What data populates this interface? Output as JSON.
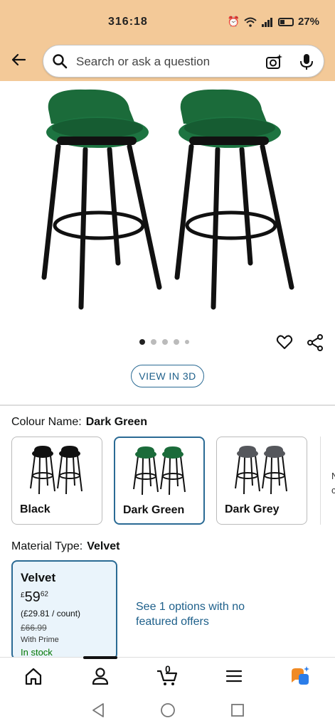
{
  "status_bar": {
    "time": "316:18",
    "battery": "27%",
    "icons": [
      "alarm-icon",
      "wifi-icon",
      "signal-icon",
      "battery-icon"
    ]
  },
  "header": {
    "back_icon": "arrow-left-icon",
    "search_placeholder": "Search or ask a question",
    "camera_icon": "camera-sparkle-icon",
    "mic_icon": "microphone-icon"
  },
  "gallery": {
    "image_count": 5,
    "active_index": 0,
    "view_3d_label": "VIEW IN 3D"
  },
  "colour": {
    "label": "Colour Name:",
    "selected": "Dark Green",
    "options": [
      {
        "label": "Black",
        "seat_color": "#111111"
      },
      {
        "label": "Dark Green",
        "seat_color": "#1b6b3a"
      },
      {
        "label": "Dark Grey",
        "seat_color": "#55575c"
      }
    ],
    "more_text": "N\nc"
  },
  "material": {
    "label": "Material Type:",
    "selected": "Velvet",
    "card": {
      "name": "Velvet",
      "currency": "£",
      "price_whole": "59",
      "price_fraction": "62",
      "unit_price": "(£29.81 / count)",
      "was_price": "£66.99",
      "prime": "With Prime",
      "stock": "In stock"
    },
    "see_options": "See 1 options with no featured offers"
  },
  "bottom_nav": {
    "cart_count": "0",
    "items": [
      "home-icon",
      "account-icon",
      "cart-icon",
      "menu-icon",
      "rufus-icon"
    ]
  },
  "colors": {
    "header_bg": "#f3c998",
    "link": "#1d5f8a",
    "selected_border": "#2a6a94",
    "in_stock": "#007600",
    "seat_green": "#1b6b3a"
  }
}
